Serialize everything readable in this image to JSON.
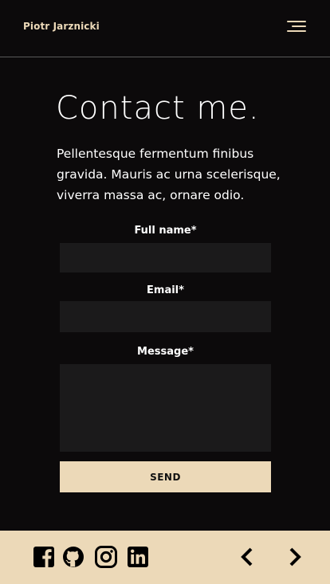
{
  "header": {
    "brand": "Piotr Jarznicki",
    "menu_icon": "hamburger-menu-icon"
  },
  "main": {
    "title": "Contact me.",
    "intro": "Pellentesque fermentum finibus gravida. Mauris ac urna scelerisque, viverra massa ac, ornare odio."
  },
  "form": {
    "full_name_label": "Full name*",
    "full_name_value": "",
    "email_label": "Email*",
    "email_value": "",
    "message_label": "Message*",
    "message_value": "",
    "send_label": "SEND"
  },
  "footer": {
    "social_icons": [
      "facebook-icon",
      "github-icon",
      "instagram-icon",
      "linkedin-icon"
    ],
    "nav_icons": [
      "chevron-left-icon",
      "chevron-right-icon"
    ]
  },
  "colors": {
    "background": "#0c0a0b",
    "accent": "#ecd9b8",
    "field": "#1b1a1b",
    "text": "#ffffff"
  }
}
